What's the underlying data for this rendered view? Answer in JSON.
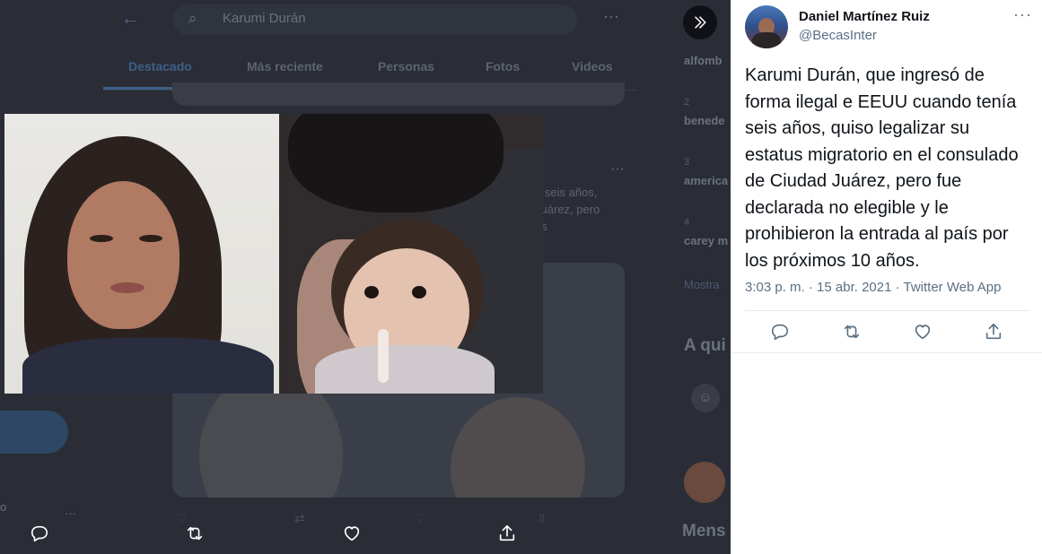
{
  "background": {
    "search_value": "Karumi Durán",
    "tabs": [
      "Destacado",
      "Más reciente",
      "Personas",
      "Fotos",
      "Videos"
    ],
    "snippet_lines": [
      "a seis años,",
      "Juárez, pero",
      "os"
    ],
    "trends": [
      {
        "num": "",
        "label": "alfomb"
      },
      {
        "num": "2",
        "label": "benede"
      },
      {
        "num": "3",
        "label": "america"
      },
      {
        "num": "4",
        "label": "carey m"
      }
    ],
    "show_more": "Mostra",
    "who_to_follow": "A qui",
    "messages": "Mens",
    "left_fragment": "o"
  },
  "tweet": {
    "author_name": "Daniel Martínez Ruiz",
    "author_handle": "@BecasInter",
    "text": "Karumi Durán, que ingresó de forma ilegal e EEUU cuando tenía seis años, quiso legalizar su estatus migratorio en el consulado de Ciudad Juárez, pero fue declarada no elegible y le prohibieron la entrada al país por los próximos 10 años.",
    "meta": "3:03 p. m. · 15 abr. 2021 · Twitter Web App"
  },
  "icons": {
    "reply": "reply-icon",
    "retweet": "retweet-icon",
    "like": "like-icon",
    "share": "share-icon",
    "collapse": "double-chevron-right-icon",
    "more": "more-horizontal-icon"
  },
  "colors": {
    "panel_bg": "#ffffff",
    "overlay_bg": "#2a2d36",
    "text_primary": "#0f1419",
    "text_secondary": "#5b7083",
    "accent": "#3d5f88"
  }
}
